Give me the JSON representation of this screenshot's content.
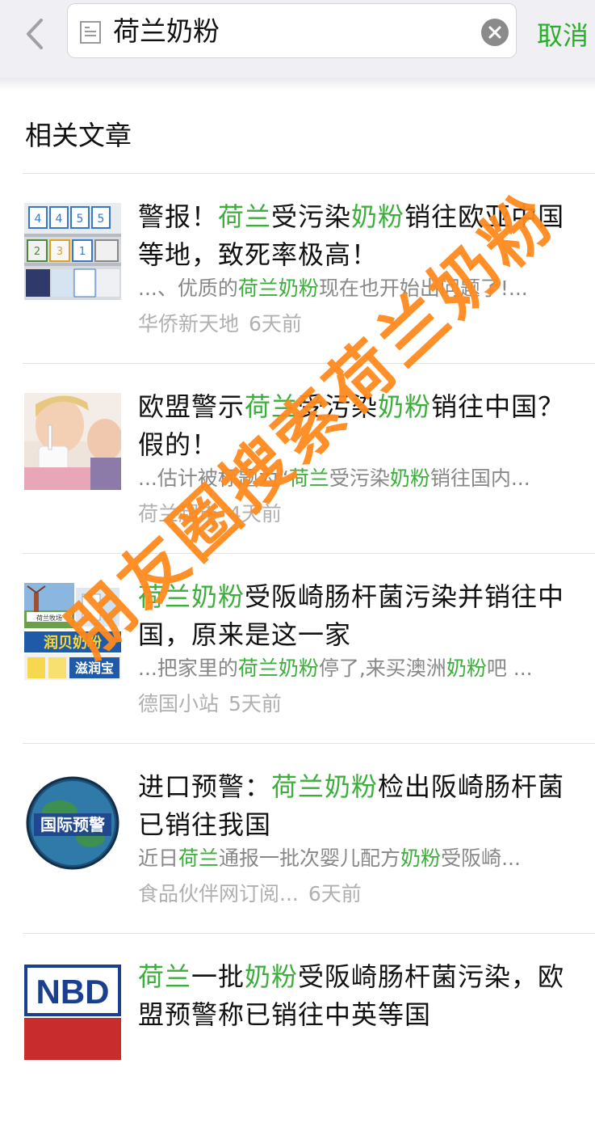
{
  "header": {
    "query": "荷兰奶粉",
    "cancel_label": "取消"
  },
  "section_title": "相关文章",
  "articles": [
    {
      "title_parts": [
        {
          "t": "警报！",
          "h": false
        },
        {
          "t": "荷兰",
          "h": true
        },
        {
          "t": "受污染",
          "h": false
        },
        {
          "t": "奶粉",
          "h": true
        },
        {
          "t": "销往欧亚中国等地，致死率极高！",
          "h": false
        }
      ],
      "snippet_parts": [
        {
          "t": "...、优质的",
          "h": false
        },
        {
          "t": "荷兰奶粉",
          "h": true
        },
        {
          "t": "现在也开始出问题了!...",
          "h": false
        }
      ],
      "source": "华侨新天地",
      "time": "6天前"
    },
    {
      "title_parts": [
        {
          "t": "欧盟警示",
          "h": false
        },
        {
          "t": "荷兰",
          "h": true
        },
        {
          "t": "受污染",
          "h": false
        },
        {
          "t": "奶粉",
          "h": true
        },
        {
          "t": "销往中国？假的！",
          "h": false
        }
      ],
      "snippet_parts": [
        {
          "t": "...估计被标题为“",
          "h": false
        },
        {
          "t": "荷兰",
          "h": true
        },
        {
          "t": "受污染",
          "h": false
        },
        {
          "t": "奶粉",
          "h": true
        },
        {
          "t": "销往国内...",
          "h": false
        }
      ],
      "source": "荷兰超市",
      "time": "4天前"
    },
    {
      "title_parts": [
        {
          "t": "荷兰奶粉",
          "h": true
        },
        {
          "t": "受阪崎肠杆菌污染并销往中国，原来是这一家",
          "h": false
        }
      ],
      "snippet_parts": [
        {
          "t": "...把家里的",
          "h": false
        },
        {
          "t": "荷兰奶粉",
          "h": true
        },
        {
          "t": "停了,来买澳洲",
          "h": false
        },
        {
          "t": "奶粉",
          "h": true
        },
        {
          "t": "吧 ...",
          "h": false
        }
      ],
      "source": "德国小站",
      "time": "5天前"
    },
    {
      "title_parts": [
        {
          "t": "进口预警：",
          "h": false
        },
        {
          "t": "荷兰奶粉",
          "h": true
        },
        {
          "t": "检出阪崎肠杆菌 已销往我国",
          "h": false
        }
      ],
      "snippet_parts": [
        {
          "t": "近日",
          "h": false
        },
        {
          "t": "荷兰",
          "h": true
        },
        {
          "t": "通报一批次婴儿配方",
          "h": false
        },
        {
          "t": "奶粉",
          "h": true
        },
        {
          "t": "受阪崎...",
          "h": false
        }
      ],
      "source": "食品伙伴网订阅...",
      "time": "6天前"
    },
    {
      "title_parts": [
        {
          "t": "荷兰",
          "h": true
        },
        {
          "t": "一批",
          "h": false
        },
        {
          "t": "奶粉",
          "h": true
        },
        {
          "t": "受阪崎肠杆菌污染，欧盟预警称已销往中英等国",
          "h": false
        }
      ],
      "snippet_parts": [],
      "source": "",
      "time": ""
    }
  ],
  "thumbs": {
    "shelf_numbers": [
      "4",
      "4",
      "5",
      "5",
      "2",
      "3",
      "1"
    ],
    "ad_small_text": "荷兰牧场",
    "ad_banner": "润贝奶粉",
    "ad_banner2": "滋润宝",
    "globe_label": "国际预警",
    "nbd_logo": "NBD"
  },
  "watermark": "朋友圈搜索荷兰奶粉",
  "colors": {
    "highlight": "#3cae3c",
    "cancel": "#2aae2a",
    "watermark": "#ff8a1e"
  }
}
